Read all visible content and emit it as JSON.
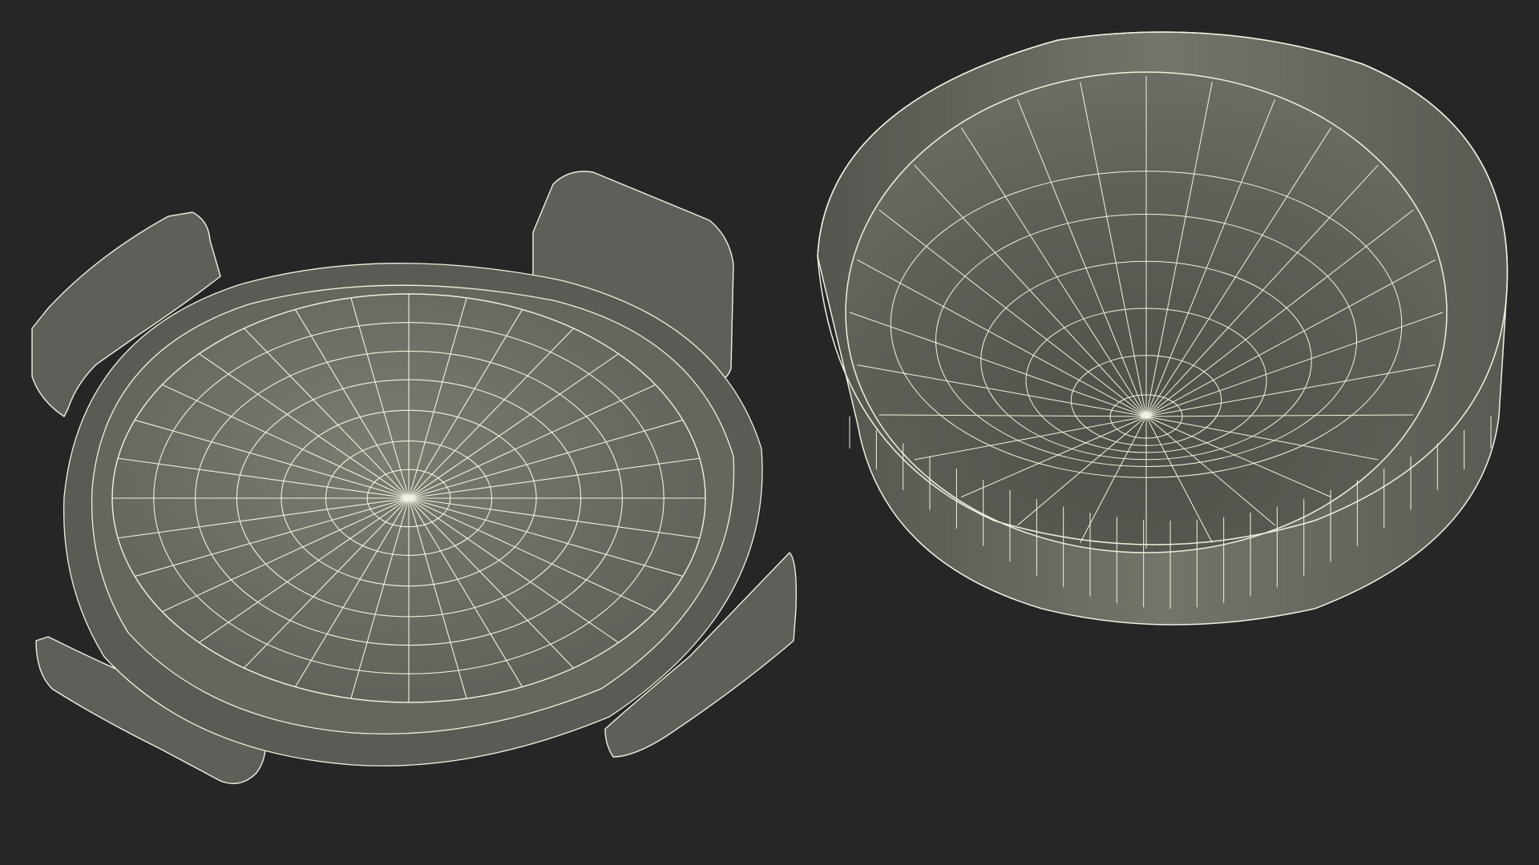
{
  "scene": {
    "background_color": "#262627",
    "surface_color": "#6e6e66",
    "surface_shadow_color": "#4a4a45",
    "wire_color": "#f2f2e2",
    "objects": [
      {
        "name": "lid-with-clips",
        "description_icon": "round-lid-wireframe"
      },
      {
        "name": "round-bowl",
        "description_icon": "round-bowl-wireframe"
      }
    ]
  }
}
